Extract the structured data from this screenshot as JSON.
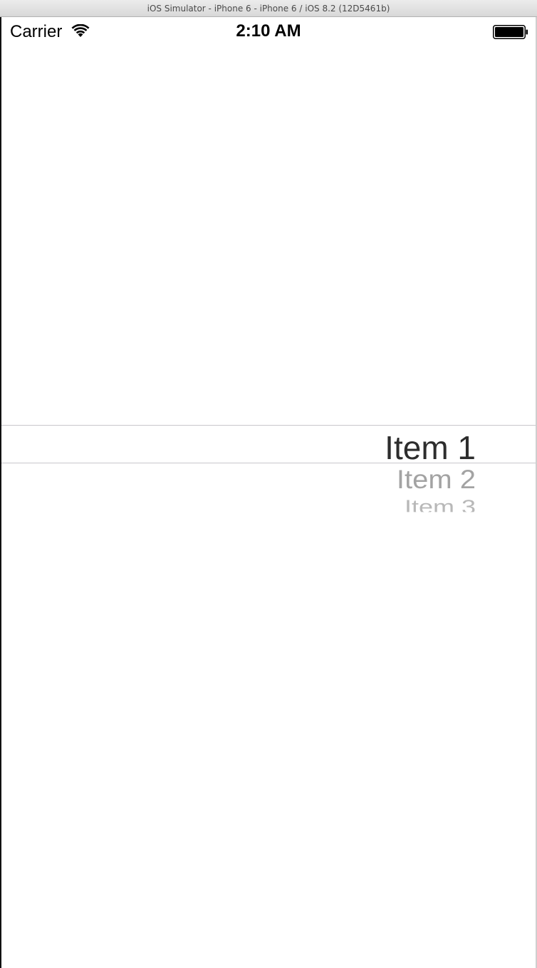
{
  "window": {
    "title": "iOS Simulator - iPhone 6 - iPhone 6 / iOS 8.2 (12D5461b)"
  },
  "status_bar": {
    "carrier": "Carrier",
    "time": "2:10 AM",
    "wifi_icon": "wifi-icon",
    "battery_icon": "battery-icon",
    "battery_level": 1.0
  },
  "picker": {
    "items": [
      "Item 1",
      "Item 2",
      "Item 3"
    ],
    "selected_index": 0
  }
}
